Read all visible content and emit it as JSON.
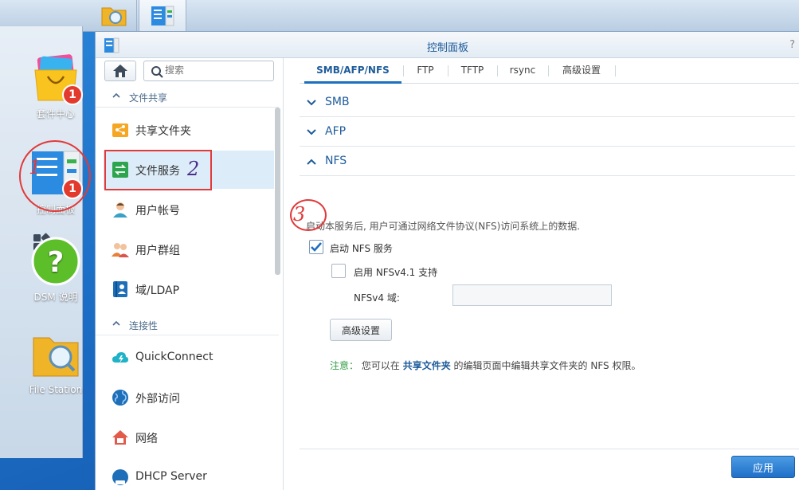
{
  "taskbar": {
    "main_menu_icon": "grid-icon",
    "apps": [
      "file-station-icon",
      "control-panel-icon"
    ]
  },
  "desktop": {
    "icons": [
      {
        "label": "套件中心",
        "badge": "1"
      },
      {
        "label": "控制面板",
        "badge": "1"
      },
      {
        "label": "DSM 说明"
      },
      {
        "label": "File Station"
      }
    ]
  },
  "window": {
    "title": "控制面板",
    "help": "?"
  },
  "sidebar": {
    "search_placeholder": "搜索",
    "sections": [
      {
        "label": "文件共享",
        "items": [
          "共享文件夹",
          "文件服务",
          "用户帐号",
          "用户群组",
          "域/LDAP"
        ]
      },
      {
        "label": "连接性",
        "items": [
          "QuickConnect",
          "外部访问",
          "网络",
          "DHCP Server"
        ]
      }
    ],
    "active_item": "文件服务"
  },
  "tabs": [
    "SMB/AFP/NFS",
    "FTP",
    "TFTP",
    "rsync",
    "高级设置"
  ],
  "accordion": [
    "SMB",
    "AFP",
    "NFS"
  ],
  "nfs": {
    "description": "启动本服务后, 用户可通过网络文件协议(NFS)访问系统上的数据.",
    "enable_label": "启动 NFS 服务",
    "enable_checked": true,
    "nfsv41_label": "启用 NFSv4.1 支持",
    "nfsv4_domain_label": "NFSv4 域:",
    "nfsv4_domain_value": "",
    "advanced_button": "高级设置",
    "note_prefix": "注意：",
    "note_text_1": "您可以在",
    "note_link": "共享文件夹",
    "note_text_2": "的编辑页面中编辑共享文件夹的 NFS 权限。"
  },
  "footer": {
    "apply": "应用"
  },
  "annotations": [
    "1",
    "2",
    "3"
  ],
  "colors": {
    "accent": "#1d6fc0",
    "annotation": "#e03a3a"
  }
}
